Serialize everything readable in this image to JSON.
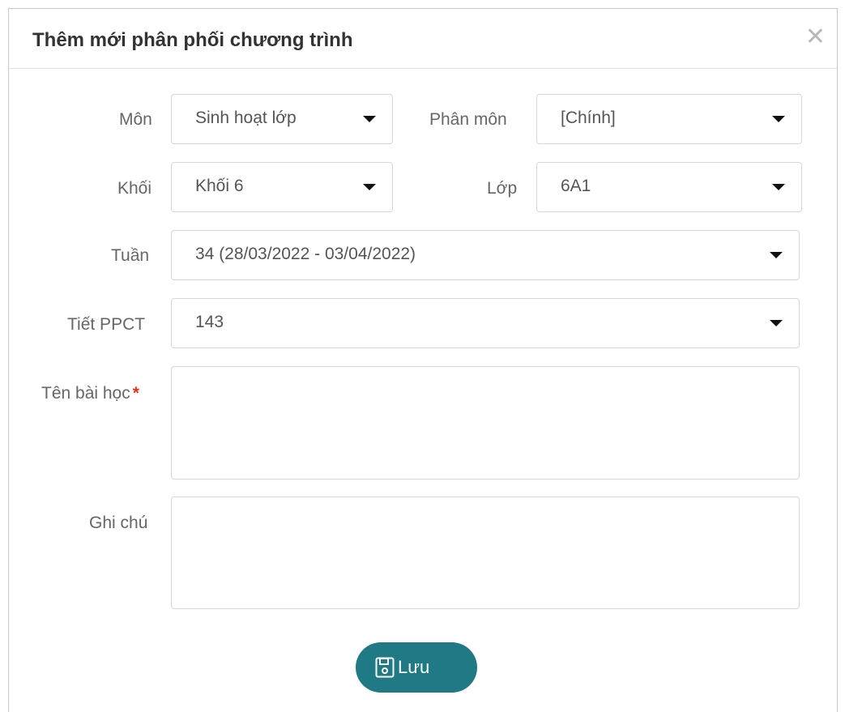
{
  "dialog": {
    "title": "Thêm mới phân phối chương trình",
    "close_symbol": "✕"
  },
  "form": {
    "mon": {
      "label": "Môn",
      "value": "Sinh hoạt lớp"
    },
    "phan_mon": {
      "label": "Phân môn",
      "value": "[Chính]"
    },
    "khoi": {
      "label": "Khối",
      "value": "Khối 6"
    },
    "lop": {
      "label": "Lớp",
      "value": "6A1"
    },
    "tuan": {
      "label": "Tuần",
      "value": "34 (28/03/2022 - 03/04/2022)"
    },
    "tiet_ppct": {
      "label": "Tiết PPCT",
      "value": "143"
    },
    "ten_bai_hoc": {
      "label": "Tên bài học",
      "required_mark": "*",
      "value": ""
    },
    "ghi_chu": {
      "label": "Ghi chú",
      "value": ""
    }
  },
  "actions": {
    "save_label": "Lưu",
    "save_icon": "floppy-disk-icon"
  },
  "colors": {
    "primary_button": "#1f7a85",
    "required": "#e2341d"
  }
}
